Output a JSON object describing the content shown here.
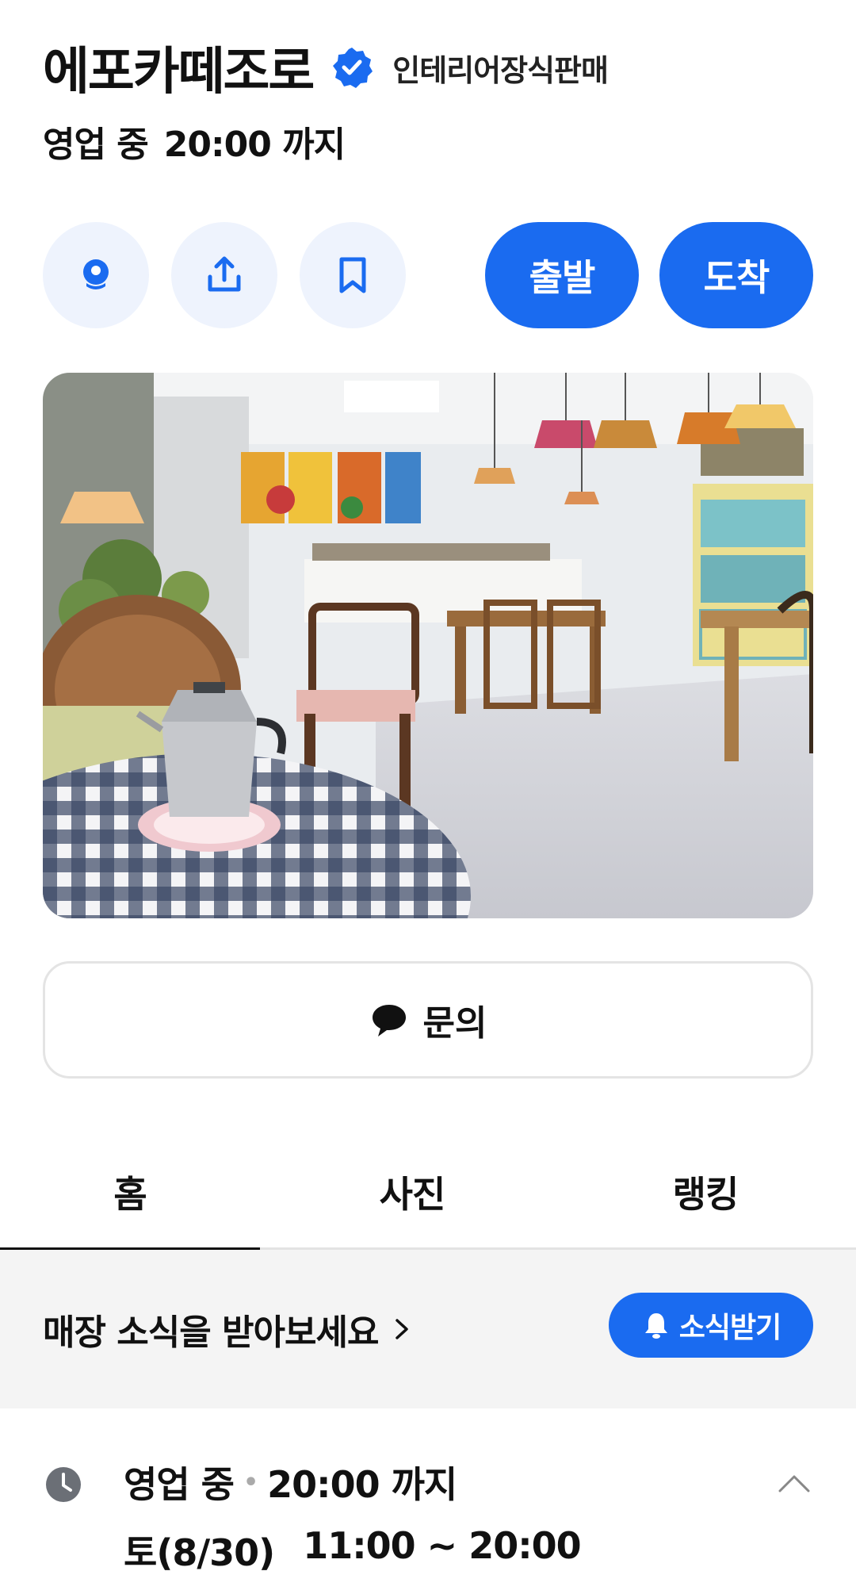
{
  "header": {
    "place_name": "에포카떼조로",
    "category": "인테리어장식판매",
    "status": "영업 중",
    "until": "20:00 까지"
  },
  "actions": {
    "directions_start": "출발",
    "directions_arrive": "도착"
  },
  "inquiry": {
    "label": "문의"
  },
  "tabs": [
    {
      "label": "홈",
      "active": true
    },
    {
      "label": "사진",
      "active": false
    },
    {
      "label": "랭킹",
      "active": false
    }
  ],
  "news": {
    "text": "매장 소식을 받아보세요",
    "subscribe_label": "소식받기"
  },
  "hours": {
    "status": "영업 중",
    "until": "20:00 까지",
    "day": "토(8/30)",
    "range": "11:00 ~ 20:00"
  },
  "colors": {
    "accent": "#1a6bf0",
    "light_accent": "#eef3fd",
    "band": "#f4f4f4"
  },
  "icons": [
    "verified-badge-icon",
    "street-view-icon",
    "share-icon",
    "bookmark-icon",
    "chat-bubble-icon",
    "chevron-right-icon",
    "bell-icon",
    "clock-icon",
    "chevron-up-icon"
  ]
}
